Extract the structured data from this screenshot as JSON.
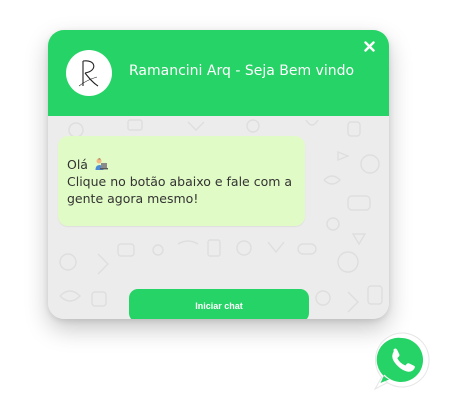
{
  "header": {
    "title": "Ramancini Arq - Seja Bem vindo",
    "close_icon": "close-icon"
  },
  "avatar": {
    "icon": "logo-r-icon"
  },
  "message": {
    "greeting": "Olá",
    "line2": "Clique no botão abaixo e fale com a",
    "line3": "gente agora mesmo!",
    "emoji_icon": "person-at-laptop-emoji"
  },
  "button": {
    "start_label": "Iniciar chat"
  },
  "floating": {
    "icon": "whatsapp-icon"
  },
  "colors": {
    "accent": "#25d366",
    "bubble": "#e1fbc6",
    "background": "#ececec",
    "text": "#333333"
  }
}
